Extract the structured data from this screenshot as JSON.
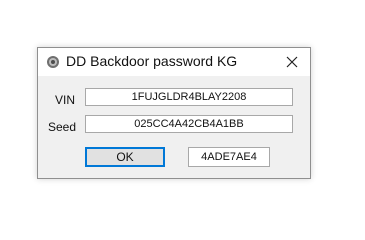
{
  "window": {
    "title": "DD Backdoor password KG",
    "icon": "gear-app-icon",
    "close_icon": "close-icon"
  },
  "form": {
    "vin_label": "VIN",
    "vin_value": "1FUJGLDR4BLAY2208",
    "seed_label": "Seed",
    "seed_value": "025CC4A42CB4A1BB",
    "ok_label": "OK",
    "result_value": "4ADE7AE4"
  },
  "colors": {
    "accent": "#0078d7",
    "window_bg": "#f0f0f0"
  }
}
